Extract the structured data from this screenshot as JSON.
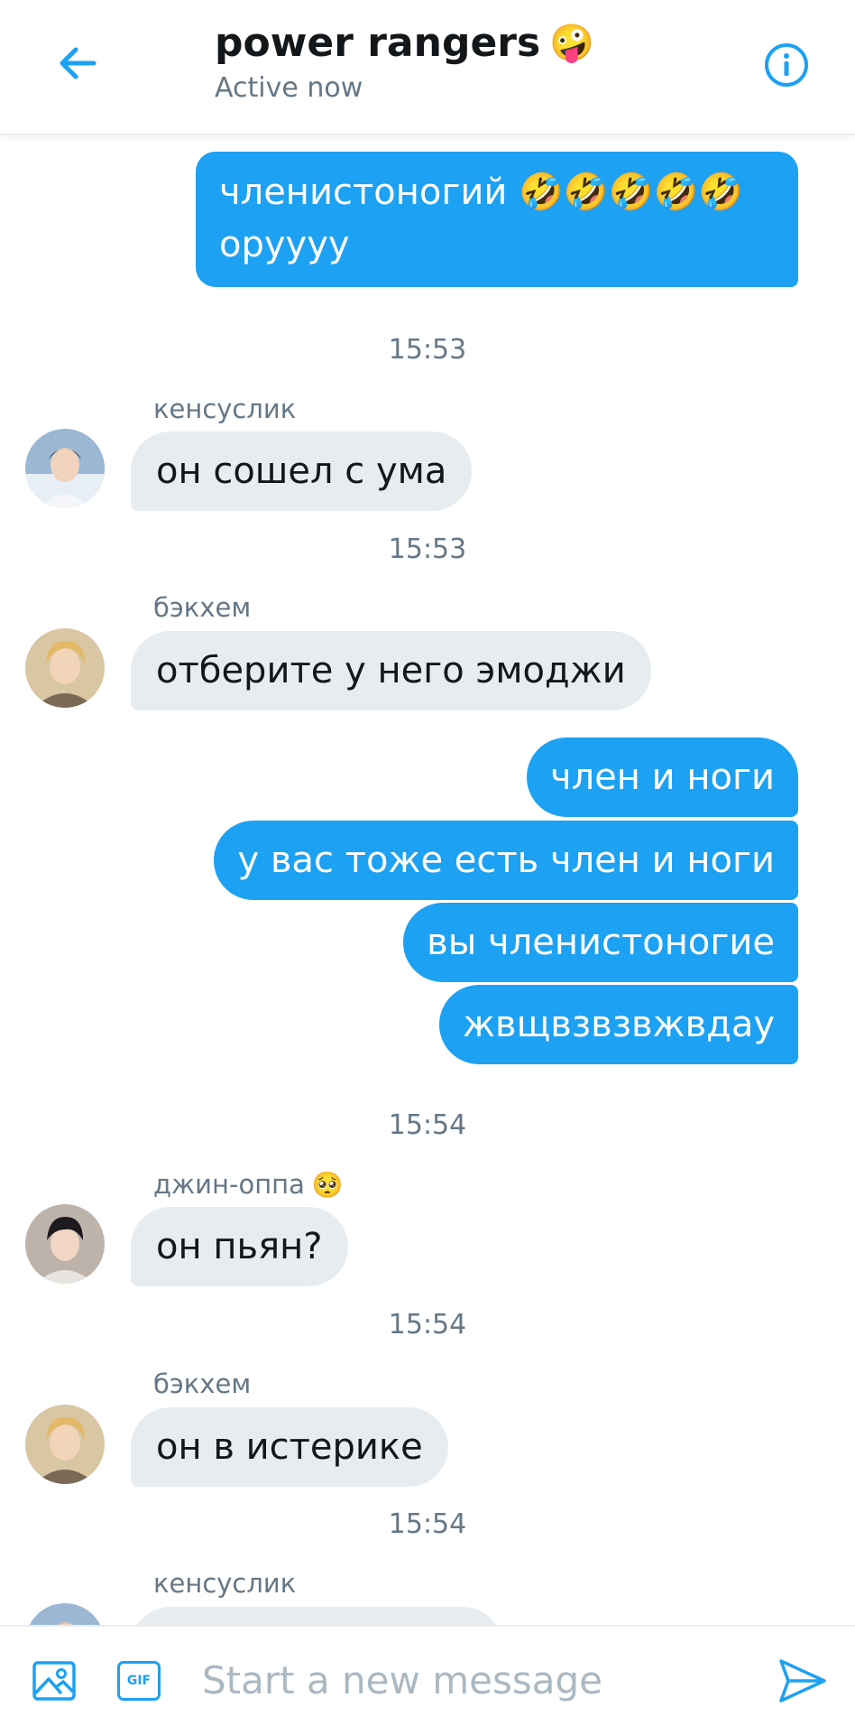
{
  "header": {
    "title": "power rangers",
    "title_emoji": "🤪",
    "subtitle": "Active now",
    "back_icon": "arrow-left-icon",
    "info_icon": "info-icon"
  },
  "messages": {
    "out1_line1": "членистоногий 🤣🤣🤣🤣🤣",
    "out1_line2": "орyyyy",
    "ts1": "15:53",
    "s1_name": "кенсуслик",
    "s1_text": "он сошел с ума",
    "ts2": "15:53",
    "s2_name": "бэкхем",
    "s2_text": "отберите у него эмоджи",
    "out2": "член и ноги",
    "out3": "у вас тоже есть член и ноги",
    "out4": "вы членистоногие",
    "out5": "жвщвзвзвжвдау",
    "ts3": "15:54",
    "s3_name": "джин-оппа",
    "s3_emoji": "🥺",
    "s3_text": "он пьян?",
    "ts4": "15:54",
    "s4_name": "бэкхем",
    "s4_text": "он в истерике",
    "ts5": "15:54",
    "s5_name": "кенсуслик"
  },
  "composer": {
    "placeholder": "Start a new message",
    "image_icon": "image-icon",
    "gif_label": "GIF",
    "send_icon": "send-icon"
  },
  "colors": {
    "accent": "#1da1f2",
    "incoming_bubble": "#e6ecf0",
    "muted_text": "#657786"
  }
}
